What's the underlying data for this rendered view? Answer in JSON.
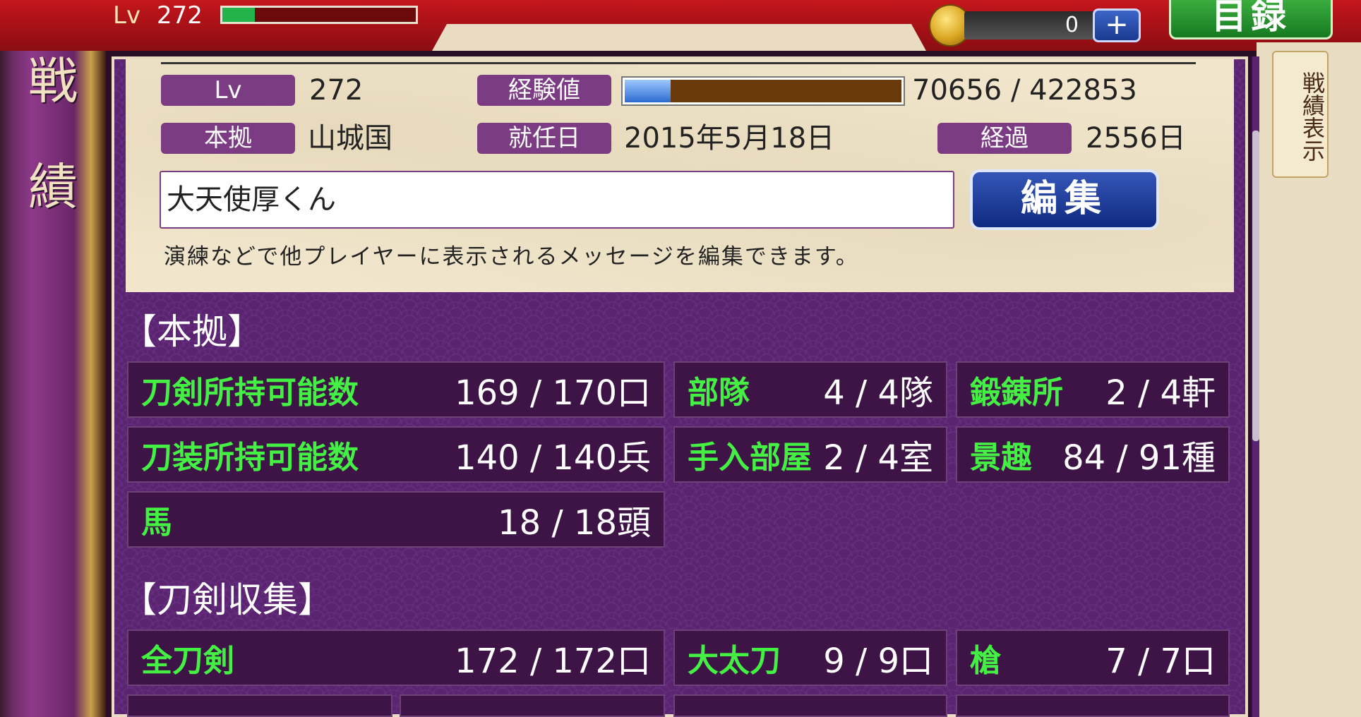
{
  "topbar": {
    "lv_label": "Lv",
    "lv_value": "272",
    "xp_fraction": 0.167,
    "coin_count": "0",
    "plus_label": "+",
    "mokuroku_label": "目録"
  },
  "sidebar": {
    "title": "戦績"
  },
  "right_tab": {
    "label": "戦績表示"
  },
  "profile": {
    "lv_label": "Lv",
    "lv_value": "272",
    "exp_label": "経験値",
    "exp_value": "70656 / 422853",
    "exp_fraction": 0.167,
    "base_label": "本拠",
    "base_value": "山城国",
    "start_label": "就任日",
    "start_value": "2015年5月18日",
    "elapsed_label": "経過",
    "elapsed_value": "2556日",
    "message_value": "大天使厚くん",
    "edit_label": "編集",
    "note": "演練などで他プレイヤーに表示されるメッセージを編集できます。"
  },
  "base_section": {
    "title": "【本拠】",
    "row1": [
      {
        "k": "刀剣所持可能数",
        "v": "169 / 170口"
      },
      {
        "k": "部隊",
        "v": "4 / 4隊"
      },
      {
        "k": "鍛錬所",
        "v": "2 / 4軒"
      }
    ],
    "row2": [
      {
        "k": "刀装所持可能数",
        "v": "140 / 140兵"
      },
      {
        "k": "手入部屋",
        "v": "2 / 4室"
      },
      {
        "k": "景趣",
        "v": "84 / 91種"
      }
    ],
    "row3": [
      {
        "k": "馬",
        "v": "18 / 18頭"
      }
    ]
  },
  "collection_section": {
    "title": "【刀剣収集】",
    "row1": [
      {
        "k": "全刀剣",
        "v": "172 / 172口"
      },
      {
        "k": "大太刀",
        "v": "9 / 9口"
      },
      {
        "k": "槍",
        "v": "7 / 7口"
      }
    ]
  },
  "colors": {
    "accent_purple": "#7b3c84",
    "stat_green": "#43f043",
    "topbar_red": "#c4161c"
  }
}
